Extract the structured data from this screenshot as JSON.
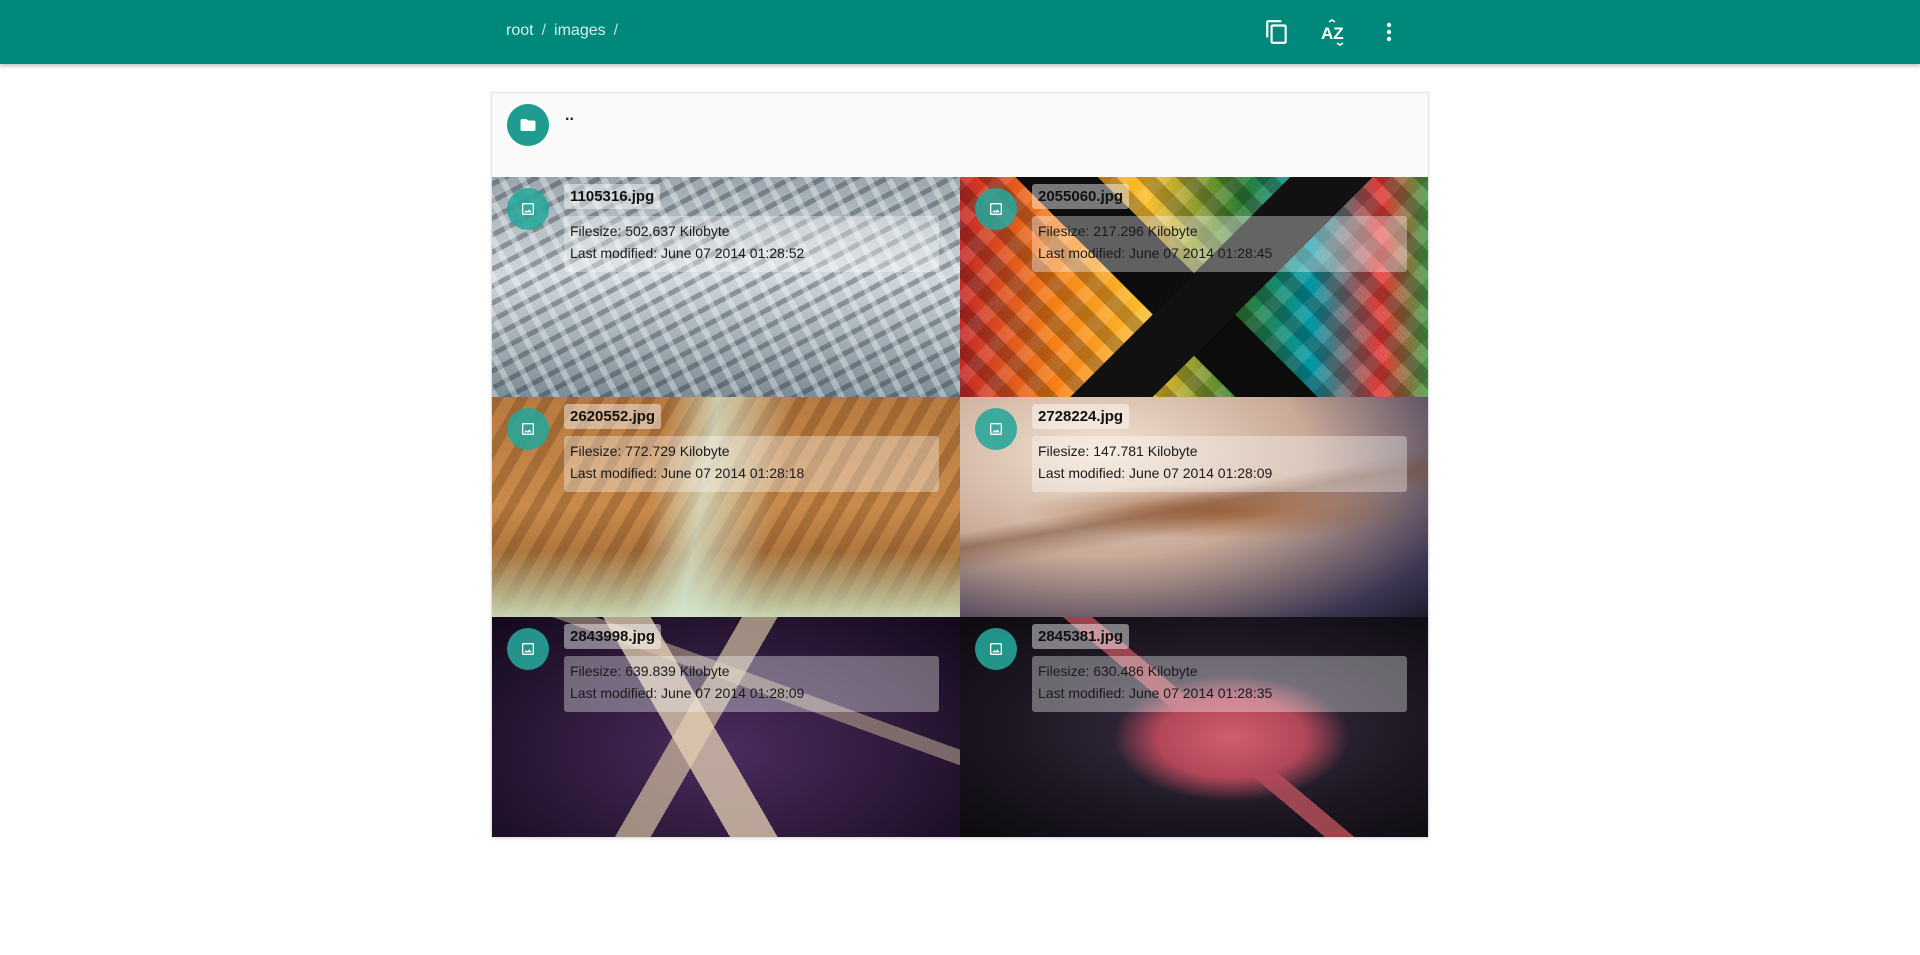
{
  "breadcrumb": {
    "items": [
      "root",
      "images"
    ],
    "separator": "/"
  },
  "toolbar": {
    "icons": [
      "copy-icon",
      "sort-az-icon",
      "more-vert-icon"
    ],
    "sort_label": "AZ"
  },
  "listing": {
    "parent": {
      "name": "..",
      "icon": "folder-icon"
    },
    "files": [
      {
        "name": "1105316.jpg",
        "filesize": "Filesize: 502.637 Kilobyte",
        "modified": "Last modified: June 07 2014 01:28:52",
        "icon": "image-icon"
      },
      {
        "name": "2055060.jpg",
        "filesize": "Filesize: 217.296 Kilobyte",
        "modified": "Last modified: June 07 2014 01:28:45",
        "icon": "image-icon"
      },
      {
        "name": "2620552.jpg",
        "filesize": "Filesize: 772.729 Kilobyte",
        "modified": "Last modified: June 07 2014 01:28:18",
        "icon": "image-icon"
      },
      {
        "name": "2728224.jpg",
        "filesize": "Filesize: 147.781 Kilobyte",
        "modified": "Last modified: June 07 2014 01:28:09",
        "icon": "image-icon"
      },
      {
        "name": "2843998.jpg",
        "filesize": "Filesize: 639.839 Kilobyte",
        "modified": "Last modified: June 07 2014 01:28:09",
        "icon": "image-icon"
      },
      {
        "name": "2845381.jpg",
        "filesize": "Filesize: 630.486 Kilobyte",
        "modified": "Last modified: June 07 2014 01:28:35",
        "icon": "image-icon"
      }
    ]
  },
  "colors": {
    "appbar": "#00897b",
    "avatar": "#26a69a"
  }
}
